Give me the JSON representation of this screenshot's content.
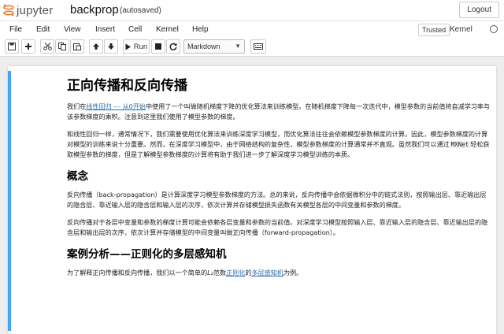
{
  "header": {
    "logo_text": "jupyter",
    "notebook_name": "backprop",
    "autosave_status": "(autosaved)",
    "logout_label": "Logout"
  },
  "menubar": {
    "items": [
      "File",
      "Edit",
      "View",
      "Insert",
      "Cell",
      "Kernel",
      "Help"
    ],
    "trusted_label": "Trusted",
    "kernel_label": "Kernel"
  },
  "toolbar": {
    "buttons": [
      "save-icon",
      "plus-icon",
      "cut-icon",
      "copy-icon",
      "paste-icon",
      "arrow-up-icon",
      "arrow-down-icon",
      "run-icon",
      "stop-icon",
      "restart-icon",
      "command-palette-icon"
    ],
    "run_label": "Run",
    "cell_type": "Markdown"
  },
  "notebook": {
    "title": "正向传播和反向传播",
    "p1": {
      "a": "我们在",
      "link1": "线性回归 --- 从0开始",
      "b": "中使用了一个叫做随机梯度下降的优化算法来训练模型。在随机梯度下降每一次迭代中，模型参数的当前值将自减学习率与该参数梯度的乘积。注意到这里我们使用了模型参数的梯度。"
    },
    "p2": {
      "a": "和线性回归一样，通常情况下，我们需要使用优化算法来训练深度学习模型，而优化算法往往会依赖模型参数梯度的计算。因此，模型参数梯度的计算对模型的训练来说十分重要。然而，在深度学习模型中，由于网络结构的复杂性，模型参数梯度的计算通常并不直观。虽然我们可以通过",
      "code": "MXNet",
      "b": "轻松获取模型参数的梯度，但是了解模型参数梯度的计算将有助于我们进一步了解深度学习模型训练的本质。"
    },
    "h2_concept": "概念",
    "p3": "反向传播（back-propagation）是计算深度学习模型参数梯度的方法。总的来说，反向传播中会依据微积分中的链式法则，按照输出层、靠近输出层的隐含层、靠近输入层的隐含层和输入层的次序，依次计算并存储模型损失函数有关模型各层的中间变量和参数的梯度。",
    "p4": "反向传播对于各层中变量和参数的梯度计算可能会依赖各层变量和参数的当前值。对深度学习模型按照输入层、靠近输入层的隐含层、靠近输出层的隐含层和输出层的次序，依次计算并存储模型的中间变量叫做正向传播（forward-propagation）。",
    "h2_case": "案例分析——正则化的多层感知机",
    "p5": {
      "a": "为了解释正向传播和反向传播，我们以一个简单的",
      "l2": "L₂",
      "b": "范数",
      "link_reg": "正则化",
      "c": "的",
      "link_mlp": "多层感知机",
      "d": "为例。"
    }
  },
  "colors": {
    "accent": "#42a5f5",
    "link": "#296eaa",
    "logo_orange": "#f37726"
  }
}
